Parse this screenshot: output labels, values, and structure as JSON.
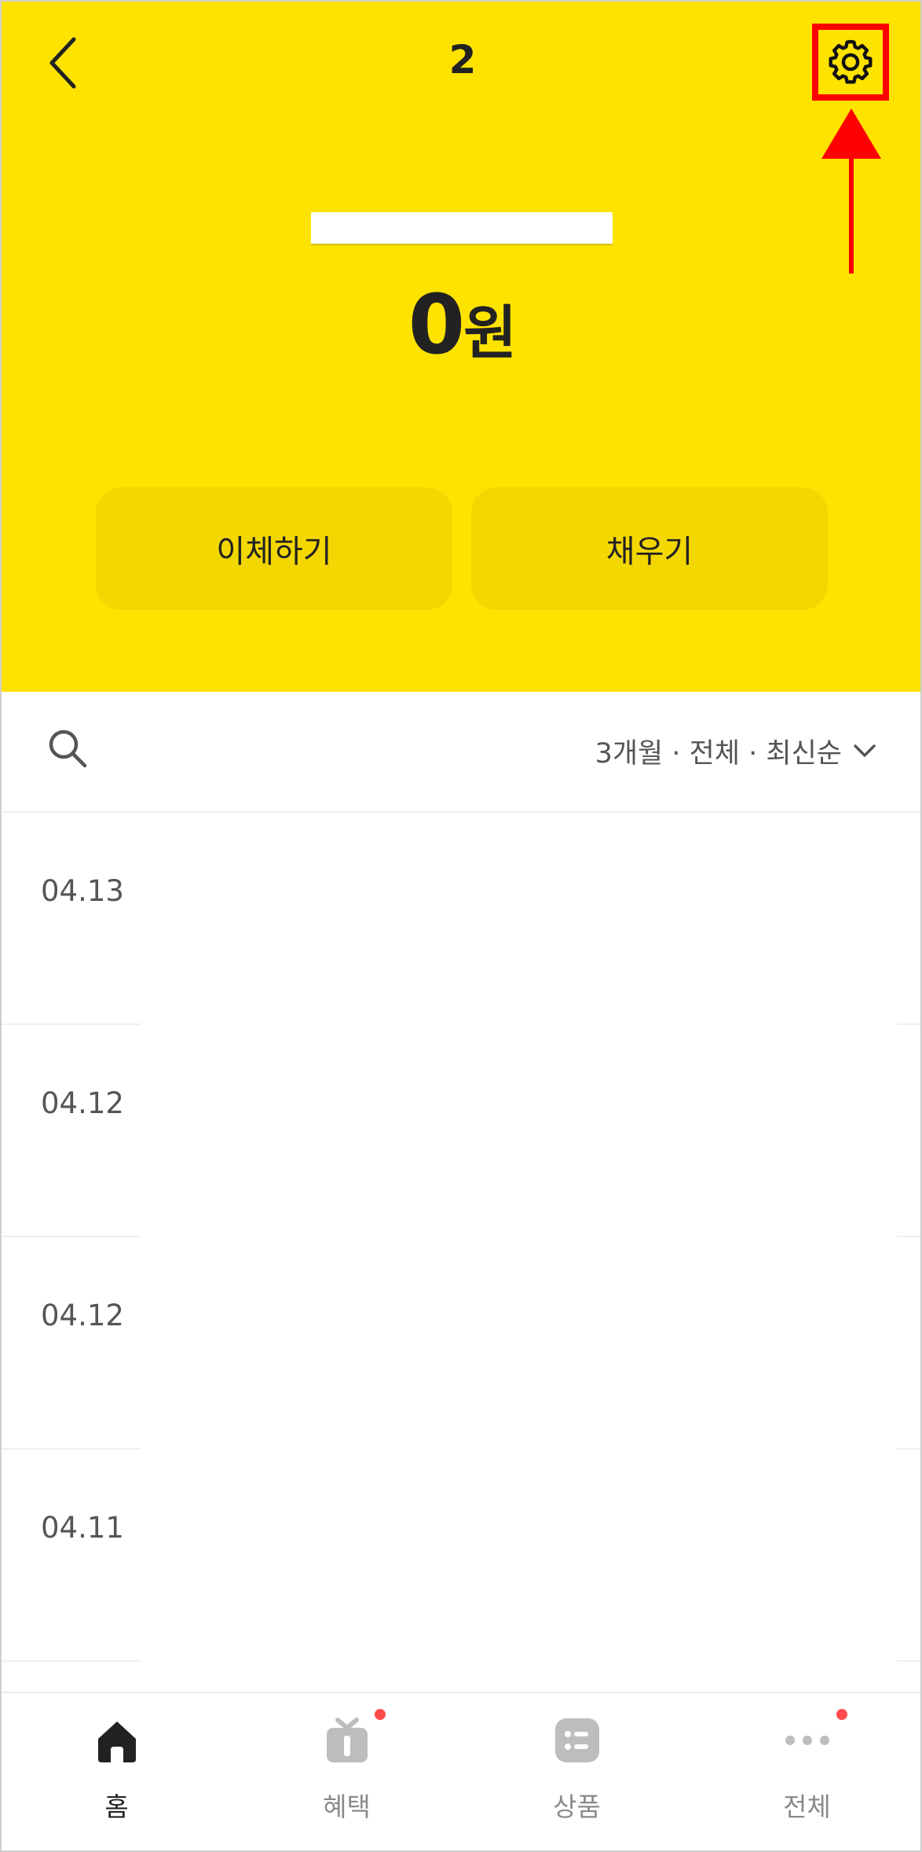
{
  "header": {
    "title": "2",
    "back_icon": "chevron-left-icon",
    "settings_icon": "gear-icon",
    "account_name": "",
    "balance_number": "0",
    "balance_unit": "원",
    "bg_color": "#ffe300"
  },
  "actions": {
    "transfer_label": "이체하기",
    "fill_label": "채우기"
  },
  "filter": {
    "search_icon": "search-icon",
    "label": "3개월 · 전체 · 최신순",
    "chevron_icon": "chevron-down-icon"
  },
  "transactions": [
    {
      "date": "04.13"
    },
    {
      "date": "04.12"
    },
    {
      "date": "04.12"
    },
    {
      "date": "04.11"
    }
  ],
  "bottom_nav": [
    {
      "label": "홈",
      "icon": "home-icon",
      "active": true,
      "badge": false
    },
    {
      "label": "혜택",
      "icon": "gift-icon",
      "active": false,
      "badge": true
    },
    {
      "label": "상품",
      "icon": "list-icon",
      "active": false,
      "badge": false
    },
    {
      "label": "전체",
      "icon": "more-icon",
      "active": false,
      "badge": true
    }
  ],
  "annotation": {
    "highlight_color": "#ff0000",
    "arrow_color": "#ff0000"
  }
}
